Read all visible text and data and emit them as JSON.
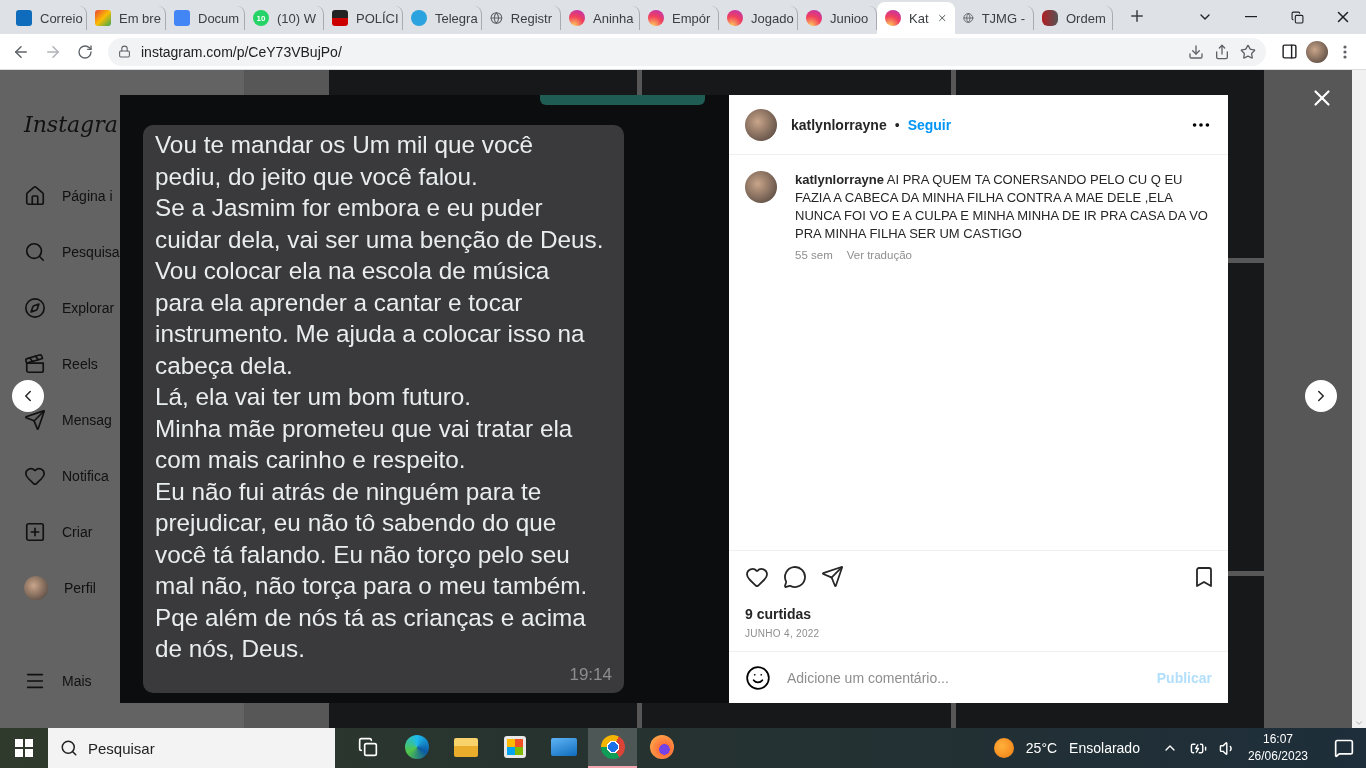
{
  "browser": {
    "tabs": [
      {
        "label": "Correio",
        "kind": "outlook",
        "selected": false
      },
      {
        "label": "Em bre",
        "kind": "gmail",
        "selected": false
      },
      {
        "label": "Docum",
        "kind": "docs",
        "selected": false
      },
      {
        "label": "(10) W",
        "kind": "whatsapp",
        "badge": "10",
        "selected": false
      },
      {
        "label": "POLÍCI",
        "kind": "police",
        "selected": false
      },
      {
        "label": "Telegra",
        "kind": "telegram",
        "selected": false
      },
      {
        "label": "Registr",
        "kind": "globe",
        "selected": false
      },
      {
        "label": "Aninha",
        "kind": "instagram",
        "selected": false
      },
      {
        "label": "Empór",
        "kind": "instagram",
        "selected": false
      },
      {
        "label": "Jogado",
        "kind": "instagram",
        "selected": false
      },
      {
        "label": "Junioo",
        "kind": "instagram",
        "selected": false
      },
      {
        "label": "Kat",
        "kind": "instagram",
        "selected": true
      },
      {
        "label": "TJMG -",
        "kind": "globe",
        "selected": false
      },
      {
        "label": "Ordem",
        "kind": "oab",
        "selected": false
      }
    ],
    "address": "instagram.com/p/CeY73VBujPo/"
  },
  "sidebar": {
    "logo": "Instagra",
    "items": [
      {
        "label": "Página i",
        "kind": "home"
      },
      {
        "label": "Pesquisa",
        "kind": "search"
      },
      {
        "label": "Explorar",
        "kind": "compass"
      },
      {
        "label": "Reels",
        "kind": "reels"
      },
      {
        "label": "Mensag",
        "kind": "send"
      },
      {
        "label": "Notifica",
        "kind": "heart"
      },
      {
        "label": "Criar",
        "kind": "plus"
      },
      {
        "label": "Perfil",
        "kind": "avatar"
      },
      {
        "label": "Mais",
        "kind": "menu"
      }
    ]
  },
  "post": {
    "message": {
      "lines": [
        "Vou te mandar os Um mil que você",
        "pediu, do jeito que você falou.",
        "Se a Jasmim for embora e eu puder",
        "cuidar dela, vai ser uma benção de Deus.",
        "Vou colocar ela na escola de música",
        "para ela aprender a cantar e tocar",
        "instrumento. Me ajuda a colocar isso na",
        "cabeça dela.",
        "Lá, ela vai ter um bom futuro.",
        "Minha mãe prometeu que vai tratar ela",
        "com mais carinho e respeito.",
        "Eu não fui atrás de ninguém para te",
        "prejudicar, eu não tô sabendo do que",
        "você tá falando. Eu não torço pelo seu",
        "mal não, não torça para o meu também.",
        "Pqe além de nós tá as crianças e acima",
        "de nós, Deus."
      ],
      "time": "19:14"
    },
    "author": "katlynlorrayne",
    "separator": "•",
    "follow": "Seguir",
    "caption": {
      "text": "**katlynlorrayne** AI PRA QUEM TA CONERSANDO PELO CU Q EU FAZIA A CABECA DA MINHA FILHA CONTRA A MAE DELE ,ELA NUNCA FOI VO E A CULPA E MINHA MINHA DE IR PRA CASA DA VO PRA MINHA FILHA SER UM CASTIGO",
      "age": "55 sem",
      "translate": "Ver tradução"
    },
    "likes": "9 curtidas",
    "date": "JUNHO 4, 2022",
    "comment": {
      "placeholder": "Adicione um comentário...",
      "submit": "Publicar"
    }
  },
  "taskbar": {
    "search": "Pesquisar",
    "apps": [
      {
        "kind": "taskview",
        "selected": false
      },
      {
        "kind": "edge",
        "selected": false
      },
      {
        "kind": "explorer",
        "selected": false
      },
      {
        "kind": "store",
        "selected": false
      },
      {
        "kind": "mail",
        "selected": false
      },
      {
        "kind": "chrome",
        "selected": true
      },
      {
        "kind": "firefox",
        "selected": false
      }
    ],
    "weather": {
      "temp": "25°C",
      "condition": "Ensolarado"
    },
    "time": "16:07",
    "date": "26/06/2023"
  }
}
